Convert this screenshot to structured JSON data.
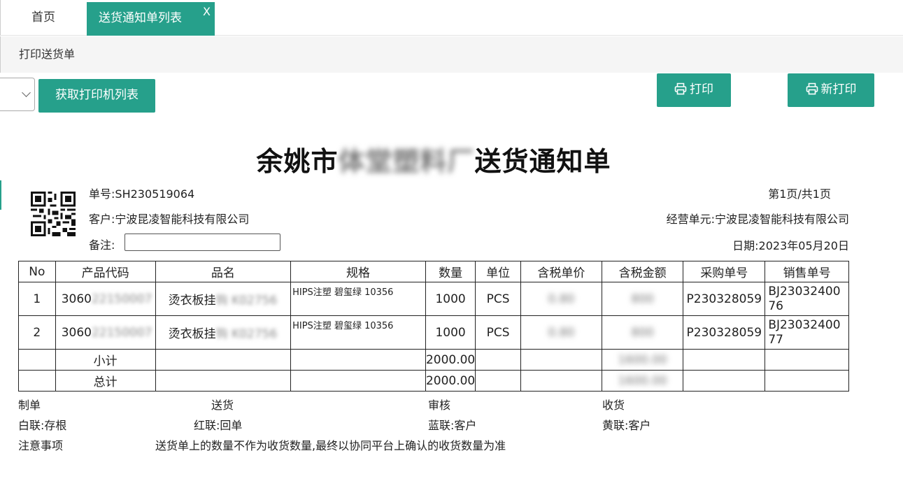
{
  "tabs": {
    "home_label": "首页",
    "active_label": "送货通知单列表",
    "close_glyph": "X"
  },
  "breadcrumb": "打印送货单",
  "toolbar": {
    "printer_select_value": "",
    "get_printers_label": "获取打印机列表",
    "print_label": "打印",
    "new_print_label": "新打印"
  },
  "document": {
    "title_prefix": "余姚市",
    "title_blurred": "体堂塑料厂",
    "title_suffix": "送货通知单",
    "order_label": "单号:",
    "order_no": "SH230519064",
    "customer_label": "客户:",
    "customer": "宁波昆凌智能科技有限公司",
    "remark_label": "备注:",
    "page_info": "第1页/共1页",
    "business_unit_label": "经营单元:",
    "business_unit": "宁波昆凌智能科技有限公司",
    "date_label": "日期:",
    "date": "2023年05月20日"
  },
  "table": {
    "headers": [
      "No",
      "产品代码",
      "品名",
      "规格",
      "数量",
      "单位",
      "含税单价",
      "含税金额",
      "采购单号",
      "销售单号"
    ],
    "rows": [
      {
        "no": "1",
        "code_prefix": "3060",
        "code_blur": "22150007",
        "name_prefix": "烫衣板挂",
        "name_blur": "钩 K02756",
        "spec": "HIPS注塑 碧玺绿 10356",
        "qty": "1000",
        "unit": "PCS",
        "price": "0.80",
        "amount": "800",
        "po": "P230328059",
        "so": "BJ2303240076"
      },
      {
        "no": "2",
        "code_prefix": "3060",
        "code_blur": "22150007",
        "name_prefix": "烫衣板挂",
        "name_blur": "钩 K02756",
        "spec": "HIPS注塑 碧玺绿 10356",
        "qty": "1000",
        "unit": "PCS",
        "price": "0.80",
        "amount": "800",
        "po": "P230328059",
        "so": "BJ2303240077"
      }
    ],
    "subtotal_label": "小计",
    "subtotal_qty": "2000.00",
    "subtotal_amount": "1600.00",
    "total_label": "总计",
    "total_qty": "2000.00",
    "total_amount": "1600.00"
  },
  "footer": {
    "maker": "制单",
    "delivery": "送货",
    "audit": "审核",
    "receive": "收货",
    "white_copy": "白联:存根",
    "red_copy": "红联:回单",
    "blue_copy": "蓝联:客户",
    "yellow_copy": "黄联:客户",
    "notes_label": "注意事项",
    "notes_text": "送货单上的数量不作为收货数量,最终以协同平台上确认的收货数量为准"
  },
  "colors": {
    "accent": "#26a08b",
    "breadcrumb_bg": "#f5f5f5"
  },
  "icons": {
    "print": "printer-icon",
    "new_print": "printer-icon",
    "qr": "qr-code-icon",
    "select": "chevron-down-icon"
  }
}
